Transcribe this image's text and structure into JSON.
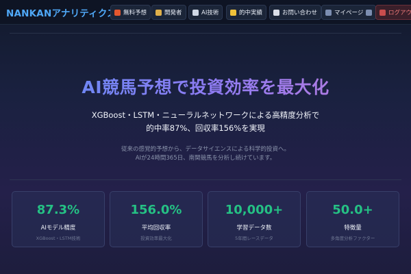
{
  "nav": {
    "brand": "NANKANアナリティクス",
    "items": [
      {
        "label": "無料予想",
        "icon": "gift-icon"
      },
      {
        "label": "開発者",
        "icon": "developer-icon"
      },
      {
        "label": "AI技術",
        "icon": "ai-icon"
      },
      {
        "label": "的中実績",
        "icon": "trophy-icon"
      },
      {
        "label": "お問い合わせ",
        "icon": "mail-icon"
      },
      {
        "label": "マイページ",
        "icon": "user-icon"
      }
    ],
    "logout_label": "ログアウト"
  },
  "hero": {
    "title": "AI競馬予想で投資効率を最大化",
    "subtitle_line1": "XGBoost・LSTM・ニューラルネットワークによる高精度分析で",
    "subtitle_line2": "的中率87%、回収率156%を実現",
    "note_line1": "従来の感覚的予想から、データサイエンスによる科学的投資へ。",
    "note_line2": "AIが24時間365日、南関競馬を分析し続けています。"
  },
  "stats": [
    {
      "value": "87.3%",
      "label": "AIモデル精度",
      "caption": "XGBoost・LSTM技術"
    },
    {
      "value": "156.0%",
      "label": "平均回収率",
      "caption": "投資効率最大化"
    },
    {
      "value": "10,000+",
      "label": "学習データ数",
      "caption": "5年間レースデータ"
    },
    {
      "value": "50.0+",
      "label": "特徴量",
      "caption": "多角度分析ファクター"
    }
  ],
  "colors": {
    "accent": "#25c184",
    "brand": "#4fa8f7",
    "logout": "#f07a7a"
  }
}
